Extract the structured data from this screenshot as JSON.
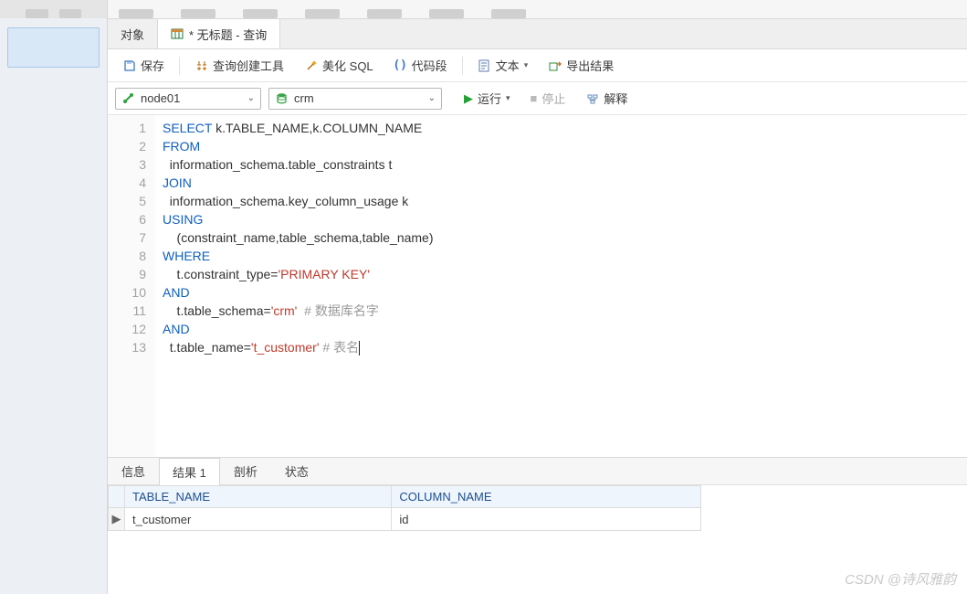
{
  "topTabs": {
    "objects": "对象",
    "queryTitle": "* 无标题 - 查询"
  },
  "toolbar": {
    "save": "保存",
    "queryBuilder": "查询创建工具",
    "beautify": "美化 SQL",
    "snippet": "代码段",
    "text": "文本",
    "export": "导出结果"
  },
  "selectors": {
    "connection": "node01",
    "database": "crm"
  },
  "runbar": {
    "run": "运行",
    "stop": "停止",
    "explain": "解释"
  },
  "code": {
    "lines": [
      {
        "n": "1",
        "segs": [
          {
            "t": "SELECT",
            "c": "kw"
          },
          {
            "t": " k.TABLE_NAME,k.COLUMN_NAME"
          }
        ]
      },
      {
        "n": "2",
        "segs": [
          {
            "t": "FROM",
            "c": "kw"
          }
        ]
      },
      {
        "n": "3",
        "segs": [
          {
            "t": "  information_schema.table_constraints t"
          }
        ]
      },
      {
        "n": "4",
        "segs": [
          {
            "t": "JOIN",
            "c": "kw"
          }
        ]
      },
      {
        "n": "5",
        "segs": [
          {
            "t": "  information_schema.key_column_usage k"
          }
        ]
      },
      {
        "n": "6",
        "segs": [
          {
            "t": "USING",
            "c": "kw"
          }
        ]
      },
      {
        "n": "7",
        "segs": [
          {
            "t": "    (constraint_name,table_schema,table_name)"
          }
        ]
      },
      {
        "n": "8",
        "segs": [
          {
            "t": "WHERE",
            "c": "kw"
          }
        ]
      },
      {
        "n": "9",
        "segs": [
          {
            "t": "    t.constraint_type="
          },
          {
            "t": "'PRIMARY KEY'",
            "c": "str"
          }
        ]
      },
      {
        "n": "10",
        "segs": [
          {
            "t": "AND",
            "c": "kw"
          }
        ]
      },
      {
        "n": "11",
        "segs": [
          {
            "t": "    t.table_schema="
          },
          {
            "t": "'crm'",
            "c": "str"
          },
          {
            "t": "  "
          },
          {
            "t": "# 数据库名字",
            "c": "cmt"
          }
        ]
      },
      {
        "n": "12",
        "segs": [
          {
            "t": "AND",
            "c": "kw"
          }
        ]
      },
      {
        "n": "13",
        "segs": [
          {
            "t": "  t.table_name="
          },
          {
            "t": "'t_customer'",
            "c": "str"
          },
          {
            "t": " "
          },
          {
            "t": "# 表名",
            "c": "cmt"
          }
        ],
        "cursor": true
      }
    ]
  },
  "resultTabs": {
    "info": "信息",
    "result1": "结果 1",
    "profile": "剖析",
    "status": "状态"
  },
  "resultGrid": {
    "headers": [
      "TABLE_NAME",
      "COLUMN_NAME"
    ],
    "rows": [
      [
        "t_customer",
        "id"
      ]
    ]
  },
  "watermark": "CSDN @诗风雅韵"
}
